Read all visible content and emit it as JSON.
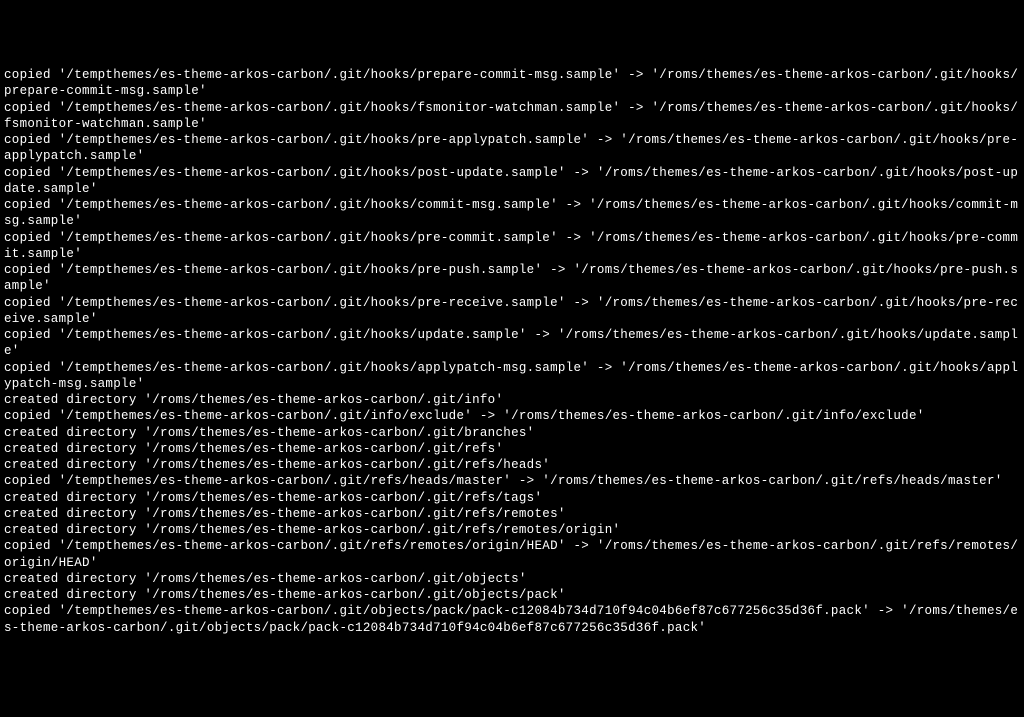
{
  "terminal": {
    "lines": [
      "copied '/tempthemes/es-theme-arkos-carbon/.git/hooks/prepare-commit-msg.sample' -> '/roms/themes/es-theme-arkos-carbon/.git/hooks/prepare-commit-msg.sample'",
      "copied '/tempthemes/es-theme-arkos-carbon/.git/hooks/fsmonitor-watchman.sample' -> '/roms/themes/es-theme-arkos-carbon/.git/hooks/fsmonitor-watchman.sample'",
      "copied '/tempthemes/es-theme-arkos-carbon/.git/hooks/pre-applypatch.sample' -> '/roms/themes/es-theme-arkos-carbon/.git/hooks/pre-applypatch.sample'",
      "copied '/tempthemes/es-theme-arkos-carbon/.git/hooks/post-update.sample' -> '/roms/themes/es-theme-arkos-carbon/.git/hooks/post-update.sample'",
      "copied '/tempthemes/es-theme-arkos-carbon/.git/hooks/commit-msg.sample' -> '/roms/themes/es-theme-arkos-carbon/.git/hooks/commit-msg.sample'",
      "copied '/tempthemes/es-theme-arkos-carbon/.git/hooks/pre-commit.sample' -> '/roms/themes/es-theme-arkos-carbon/.git/hooks/pre-commit.sample'",
      "copied '/tempthemes/es-theme-arkos-carbon/.git/hooks/pre-push.sample' -> '/roms/themes/es-theme-arkos-carbon/.git/hooks/pre-push.sample'",
      "copied '/tempthemes/es-theme-arkos-carbon/.git/hooks/pre-receive.sample' -> '/roms/themes/es-theme-arkos-carbon/.git/hooks/pre-receive.sample'",
      "copied '/tempthemes/es-theme-arkos-carbon/.git/hooks/update.sample' -> '/roms/themes/es-theme-arkos-carbon/.git/hooks/update.sample'",
      "copied '/tempthemes/es-theme-arkos-carbon/.git/hooks/applypatch-msg.sample' -> '/roms/themes/es-theme-arkos-carbon/.git/hooks/applypatch-msg.sample'",
      "created directory '/roms/themes/es-theme-arkos-carbon/.git/info'",
      "copied '/tempthemes/es-theme-arkos-carbon/.git/info/exclude' -> '/roms/themes/es-theme-arkos-carbon/.git/info/exclude'",
      "created directory '/roms/themes/es-theme-arkos-carbon/.git/branches'",
      "created directory '/roms/themes/es-theme-arkos-carbon/.git/refs'",
      "created directory '/roms/themes/es-theme-arkos-carbon/.git/refs/heads'",
      "copied '/tempthemes/es-theme-arkos-carbon/.git/refs/heads/master' -> '/roms/themes/es-theme-arkos-carbon/.git/refs/heads/master'",
      "created directory '/roms/themes/es-theme-arkos-carbon/.git/refs/tags'",
      "created directory '/roms/themes/es-theme-arkos-carbon/.git/refs/remotes'",
      "created directory '/roms/themes/es-theme-arkos-carbon/.git/refs/remotes/origin'",
      "copied '/tempthemes/es-theme-arkos-carbon/.git/refs/remotes/origin/HEAD' -> '/roms/themes/es-theme-arkos-carbon/.git/refs/remotes/origin/HEAD'",
      "created directory '/roms/themes/es-theme-arkos-carbon/.git/objects'",
      "created directory '/roms/themes/es-theme-arkos-carbon/.git/objects/pack'",
      "copied '/tempthemes/es-theme-arkos-carbon/.git/objects/pack/pack-c12084b734d710f94c04b6ef87c677256c35d36f.pack' -> '/roms/themes/es-theme-arkos-carbon/.git/objects/pack/pack-c12084b734d710f94c04b6ef87c677256c35d36f.pack'"
    ]
  }
}
